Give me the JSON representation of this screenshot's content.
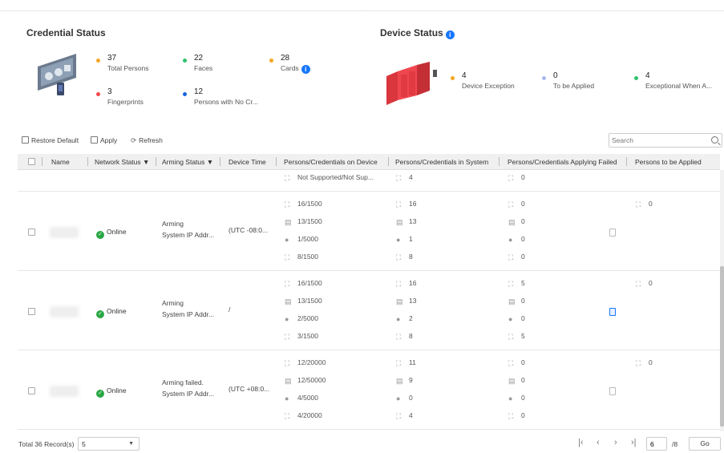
{
  "credential_status": {
    "title": "Credential Status",
    "stats": [
      {
        "value": "37",
        "label": "Total Persons",
        "color": "#f5a623"
      },
      {
        "value": "22",
        "label": "Faces",
        "color": "#2fc26b"
      },
      {
        "value": "28",
        "label": "Cards",
        "color": "#f5a623"
      },
      {
        "value": "3",
        "label": "Fingerprints",
        "color": "#f5464a"
      },
      {
        "value": "12",
        "label": "Persons with No Cr...",
        "color": "#1665e0"
      }
    ]
  },
  "device_status": {
    "title": "Device Status",
    "stats": [
      {
        "value": "4",
        "label": "Device Exception",
        "color": "#f5a623"
      },
      {
        "value": "0",
        "label": "To be Applied",
        "color": "#a9b8f0"
      },
      {
        "value": "4",
        "label": "Exceptional When A...",
        "color": "#2fc26b"
      }
    ]
  },
  "toolbar": {
    "restore_label": "Restore Default",
    "apply_label": "Apply",
    "refresh_label": "Refresh",
    "search_placeholder": "Search"
  },
  "table": {
    "headers": {
      "name": "Name",
      "network": "Network Status",
      "arming": "Arming Status",
      "device_time": "Device Time",
      "on_device": "Persons/Credentials on Device",
      "in_system": "Persons/Credentials in System",
      "failed": "Persons/Credentials Applying Failed",
      "to_apply": "Persons to be Applied"
    },
    "partial_row": {
      "on_device": "Not Supported/Not Sup...",
      "in_system": "4",
      "failed": "0"
    },
    "rows": [
      {
        "network": "Online",
        "arming_line1": "Arming",
        "arming_line2": "System IP Addr...",
        "device_time": "(UTC -08:0...",
        "on_device": [
          "16/1500",
          "13/1500",
          "1/5000",
          "8/1500"
        ],
        "in_system": [
          "16",
          "13",
          "1",
          "8"
        ],
        "failed": [
          "0",
          "0",
          "0",
          "0"
        ],
        "to_apply": "0"
      },
      {
        "network": "Online",
        "arming_line1": "Arming",
        "arming_line2": "System IP Addr...",
        "device_time": "/",
        "on_device": [
          "16/1500",
          "13/1500",
          "2/5000",
          "3/1500"
        ],
        "in_system": [
          "16",
          "13",
          "2",
          "8"
        ],
        "failed": [
          "5",
          "0",
          "0",
          "5"
        ],
        "to_apply": "0"
      },
      {
        "network": "Online",
        "arming_line1": "Arming failed.",
        "arming_line2": "System IP Addr...",
        "device_time": "(UTC +08:0...",
        "on_device": [
          "12/20000",
          "12/50000",
          "4/5000",
          "4/20000"
        ],
        "in_system": [
          "11",
          "9",
          "0",
          "4"
        ],
        "failed": [
          "0",
          "0",
          "0",
          "0"
        ],
        "to_apply": "0"
      }
    ]
  },
  "footer": {
    "total_label": "Total 36 Record(s)",
    "page_size": "5",
    "current_page": "6",
    "total_pages": "/8",
    "go_label": "Go"
  }
}
